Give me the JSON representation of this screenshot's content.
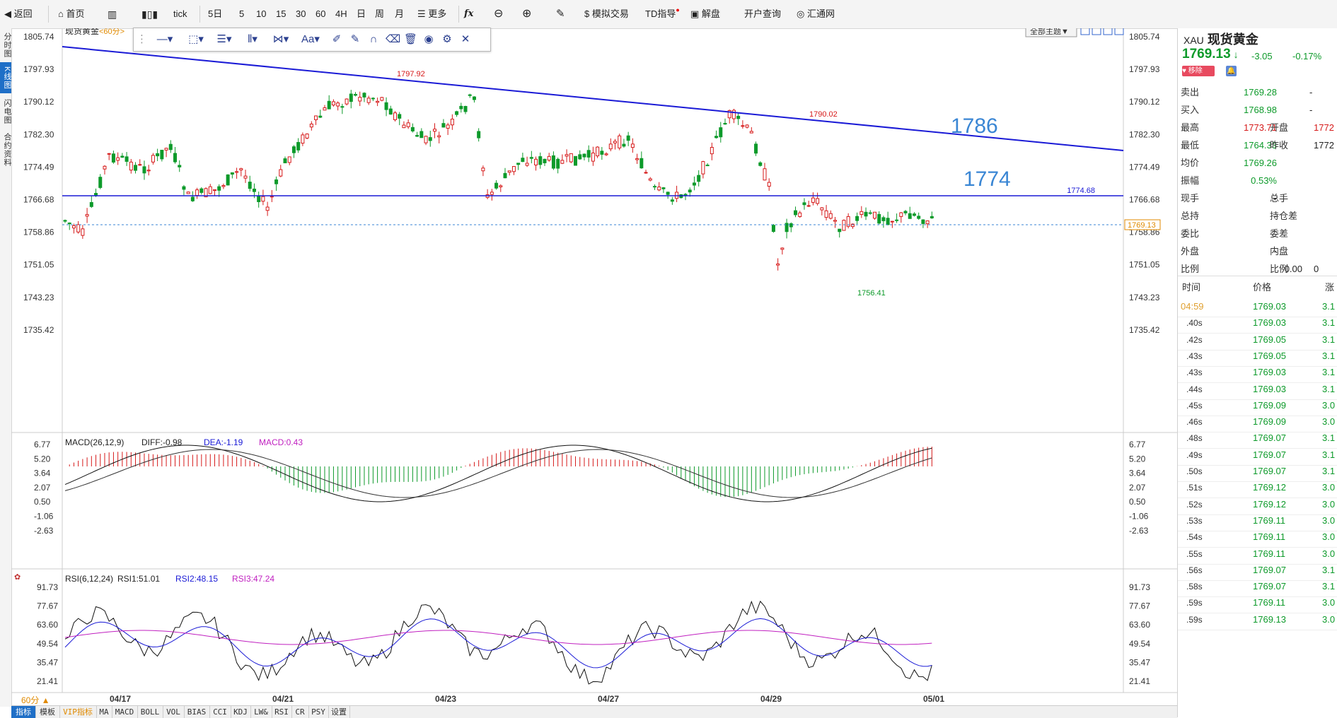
{
  "toolbar": {
    "back": "返回",
    "home": "首页",
    "tick": "tick",
    "periods": [
      "5日",
      "5",
      "10",
      "15",
      "30",
      "60",
      "4H",
      "日",
      "周",
      "月"
    ],
    "more": "更多",
    "fx": "fx",
    "sim_trade": "模拟交易",
    "td": "TD指导",
    "jiepan": "解盘",
    "open_account": "开户查询",
    "huitong": "汇通网"
  },
  "left_tabs": [
    "分时图",
    "K线图",
    "闪电图",
    "合约资料"
  ],
  "chart": {
    "instrument": "现货黄金",
    "period_tag": "<60分>",
    "all_themes": "全部主题▼",
    "price_axis": [
      "1805.74",
      "1797.93",
      "1790.12",
      "1782.30",
      "1774.49",
      "1766.68",
      "1758.86",
      "1751.05",
      "1743.23",
      "1735.42"
    ],
    "date_axis": [
      "04/17",
      "04/21",
      "04/23",
      "04/27",
      "04/29",
      "05/01"
    ],
    "labels": {
      "high1": "1797.92",
      "high2": "1790.02",
      "low": "1756.41",
      "hline": "1774.68",
      "current": "1769.13"
    },
    "annotations": {
      "a1786": "1786",
      "a1774": "1774"
    },
    "period_selector": "60分 ▲"
  },
  "macd": {
    "title": "MACD(26,12,9)",
    "diff": "DIFF:-0.98",
    "dea": "DEA:-1.19",
    "macd": "MACD:0.43",
    "axis": [
      "6.77",
      "5.20",
      "3.64",
      "2.07",
      "0.50",
      "-1.06",
      "-2.63"
    ]
  },
  "rsi": {
    "title": "RSI(6,12,24)",
    "rsi1": "RSI1:51.01",
    "rsi2": "RSI2:48.15",
    "rsi3": "RSI3:47.24",
    "axis": [
      "91.73",
      "77.67",
      "63.60",
      "49.54",
      "35.47",
      "21.41"
    ]
  },
  "bottom_tabs": [
    "指标",
    "模板",
    "VIP指标",
    "MA",
    "MACD",
    "BOLL",
    "VOL",
    "BIAS",
    "CCI",
    "KDJ",
    "LW&",
    "RSI",
    "CR",
    "PSY",
    "设置"
  ],
  "quote": {
    "code": "XAU",
    "name": "现货黄金",
    "price": "1769.13",
    "change": "-3.05",
    "pct": "-0.17%",
    "remove": "移除",
    "rows": [
      {
        "l1": "卖出",
        "v1": "1769.28",
        "l2": "",
        "v2": "-"
      },
      {
        "l1": "买入",
        "v1": "1768.98",
        "l2": "",
        "v2": "-"
      },
      {
        "l1": "最高",
        "v1": "1773.71",
        "l2": "开盘",
        "v2": "1772"
      },
      {
        "l1": "最低",
        "v1": "1764.33",
        "l2": "昨收",
        "v2": "1772"
      },
      {
        "l1": "均价",
        "v1": "1769.26",
        "l2": "",
        "v2": ""
      },
      {
        "l1": "振幅",
        "v1": "0.53%",
        "l2": "",
        "v2": ""
      },
      {
        "l1": "现手",
        "v1": "-",
        "l2": "总手",
        "v2": ""
      },
      {
        "l1": "总持",
        "v1": "-",
        "l2": "持仓差",
        "v2": ""
      },
      {
        "l1": "委比",
        "v1": "-",
        "l2": "委差",
        "v2": ""
      },
      {
        "l1": "外盘",
        "v1": "-",
        "l2": "内盘",
        "v2": ""
      },
      {
        "l1": "比例",
        "v1": "0.00",
        "l2": "比例",
        "v2": "0"
      }
    ],
    "tick_header": {
      "time": "时间",
      "price": "价格",
      "chg": "涨"
    },
    "ticks": [
      {
        "t": "04:59",
        "p": "1769.03",
        "c": "3.1"
      },
      {
        "t": ".40s",
        "p": "1769.03",
        "c": "3.1"
      },
      {
        "t": ".42s",
        "p": "1769.05",
        "c": "3.1"
      },
      {
        "t": ".43s",
        "p": "1769.05",
        "c": "3.1"
      },
      {
        "t": ".43s",
        "p": "1769.03",
        "c": "3.1"
      },
      {
        "t": ".44s",
        "p": "1769.03",
        "c": "3.1"
      },
      {
        "t": ".45s",
        "p": "1769.09",
        "c": "3.0"
      },
      {
        "t": ".46s",
        "p": "1769.09",
        "c": "3.0"
      },
      {
        "t": ".48s",
        "p": "1769.07",
        "c": "3.1"
      },
      {
        "t": ".49s",
        "p": "1769.07",
        "c": "3.1"
      },
      {
        "t": ".50s",
        "p": "1769.07",
        "c": "3.1"
      },
      {
        "t": ".51s",
        "p": "1769.12",
        "c": "3.0"
      },
      {
        "t": ".52s",
        "p": "1769.12",
        "c": "3.0"
      },
      {
        "t": ".53s",
        "p": "1769.11",
        "c": "3.0"
      },
      {
        "t": ".54s",
        "p": "1769.11",
        "c": "3.0"
      },
      {
        "t": ".55s",
        "p": "1769.11",
        "c": "3.0"
      },
      {
        "t": ".56s",
        "p": "1769.07",
        "c": "3.1"
      },
      {
        "t": ".58s",
        "p": "1769.07",
        "c": "3.1"
      },
      {
        "t": ".59s",
        "p": "1769.11",
        "c": "3.0"
      },
      {
        "t": ".59s",
        "p": "1769.13",
        "c": "3.0"
      }
    ]
  },
  "colors": {
    "up": "#d61a1a",
    "down": "#0d9a2a",
    "trend": "#1a1ad6",
    "annotation": "#3a86d4",
    "current": "#e08a00"
  }
}
